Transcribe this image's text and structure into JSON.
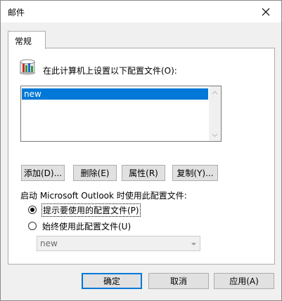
{
  "window": {
    "title": "邮件"
  },
  "tab": {
    "label": "常规"
  },
  "panel": {
    "header": "在此计算机上设置以下配置文件(O):",
    "profiles": [
      "new"
    ],
    "selected_profile": "new",
    "buttons": {
      "add": "添加(D)...",
      "delete": "删除(E)",
      "properties": "属性(R)",
      "copy": "复制(Y)..."
    },
    "startup_label": "启动 Microsoft Outlook 时使用此配置文件:",
    "radio_prompt": "提示要使用的配置文件(P)",
    "radio_always": "始终使用此配置文件(U)",
    "radio_selected": "prompt",
    "always_profile_value": "new"
  },
  "footer": {
    "ok": "确定",
    "cancel": "取消",
    "apply": "应用(A)"
  },
  "colors": {
    "accent": "#0078d7",
    "dialog_bg": "#f0f0f0"
  }
}
